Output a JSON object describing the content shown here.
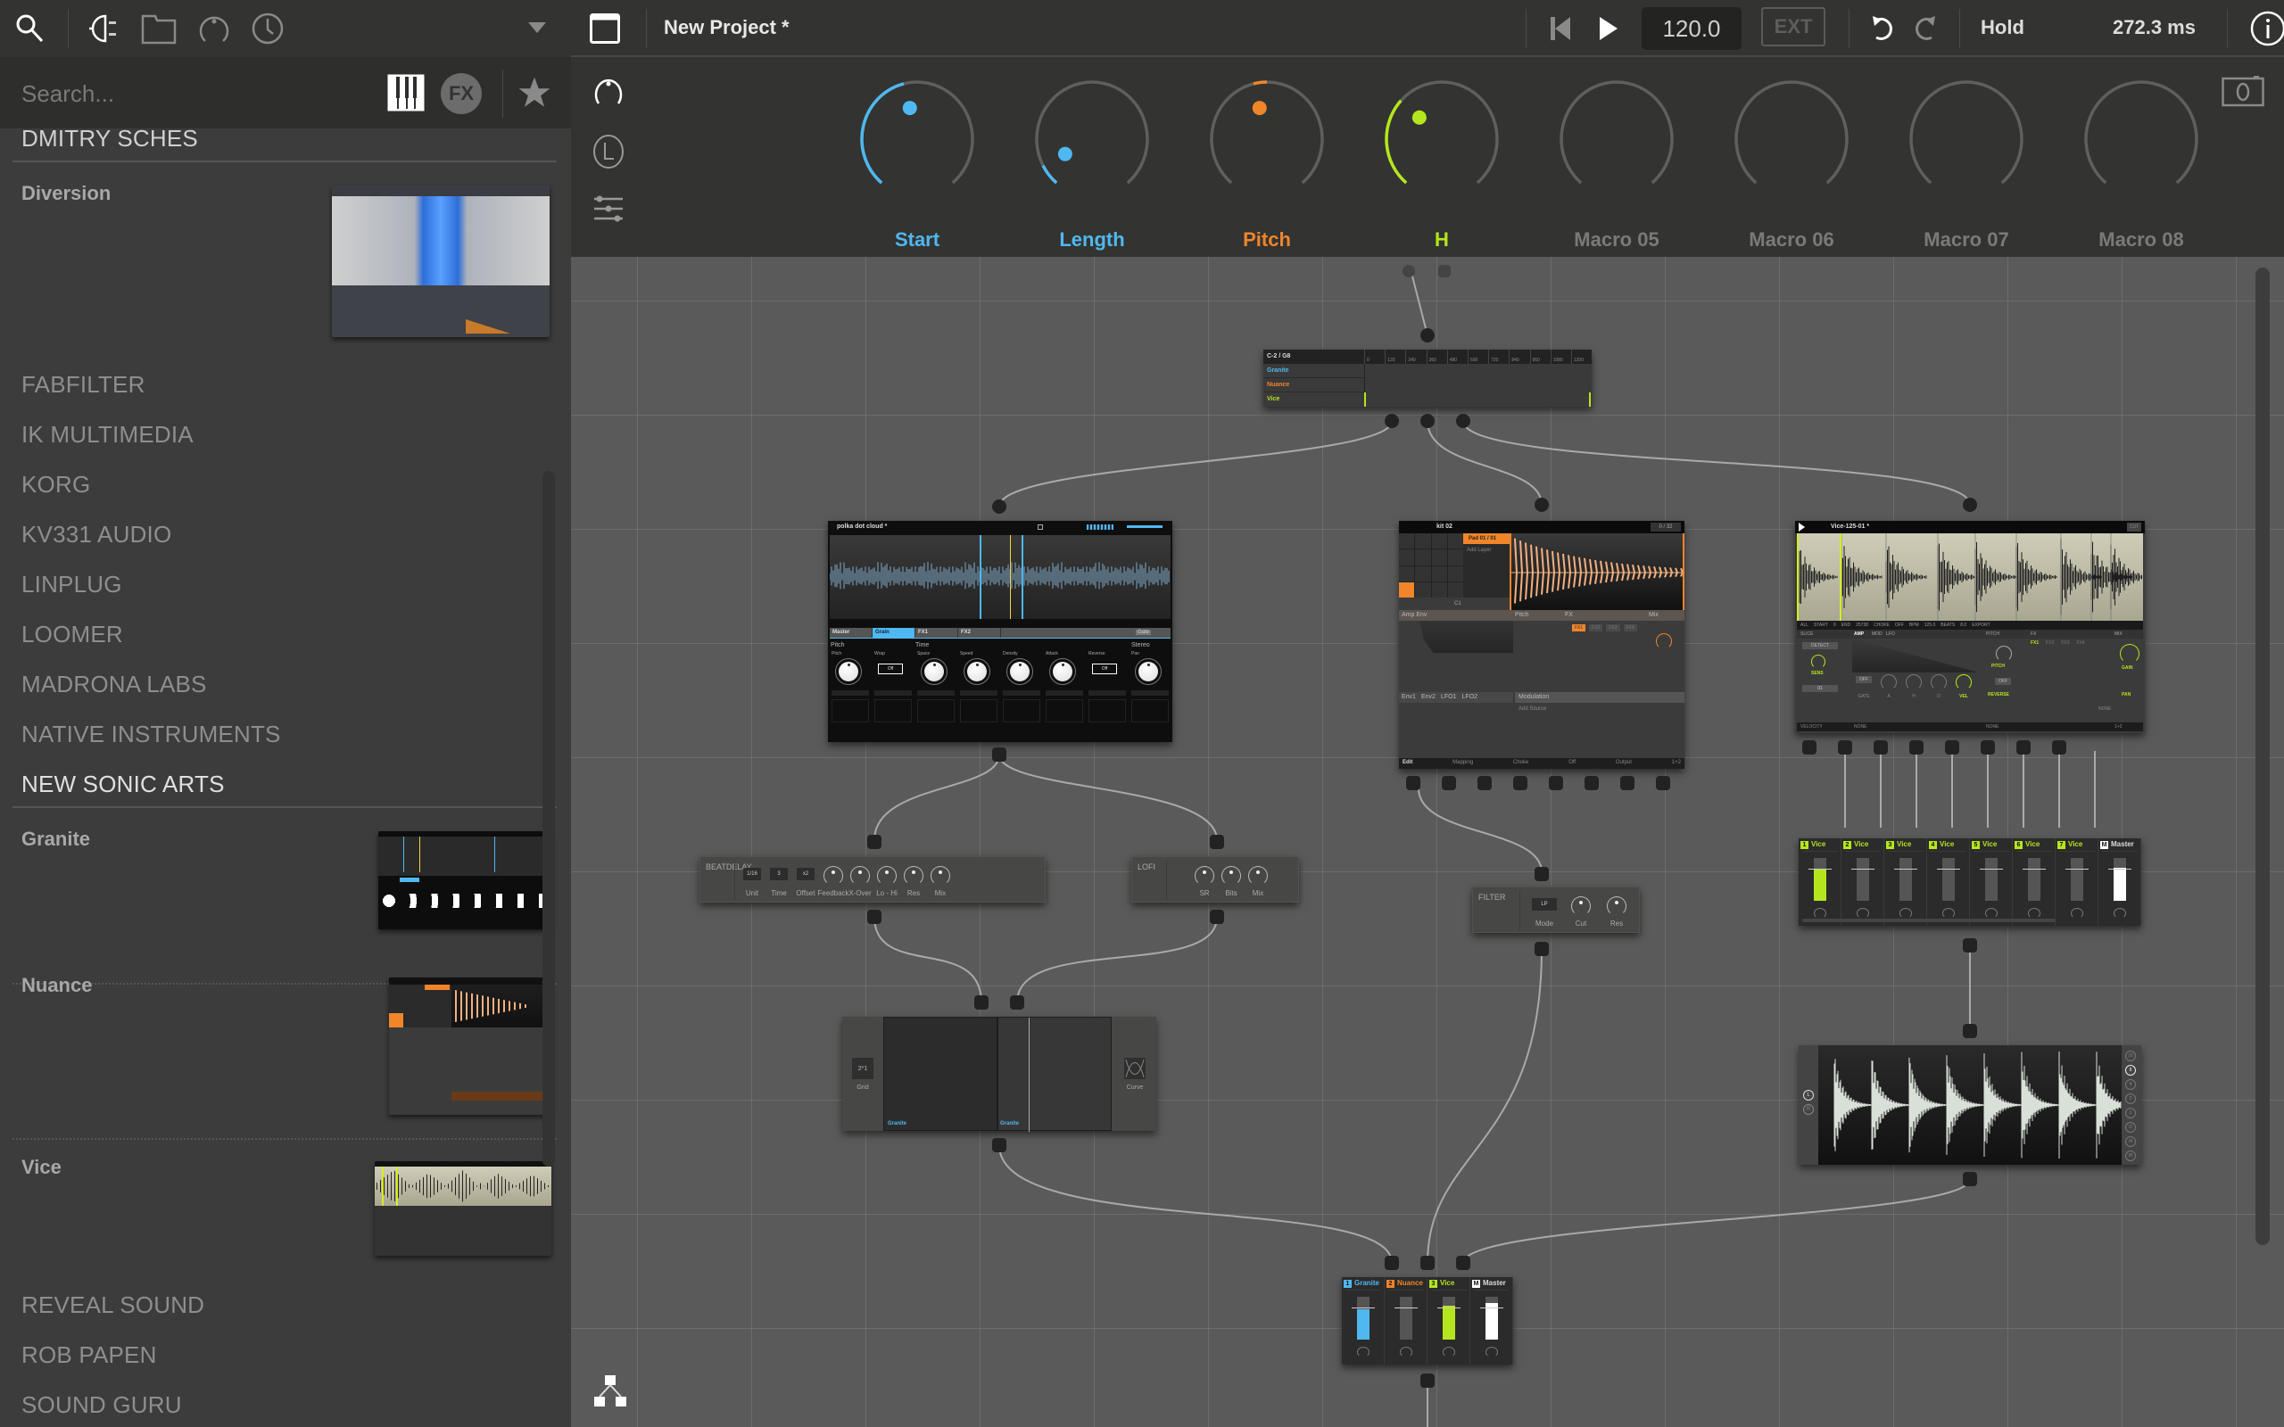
{
  "sidebar": {
    "search_placeholder": "Search...",
    "icons": [
      "search-icon",
      "plugin-icon",
      "folder-icon",
      "macro-knob-icon",
      "history-clock-icon",
      "dropdown-triangle-icon"
    ],
    "filter_icons": [
      "instrument-piano-icon",
      "fx-icon",
      "favorites-star-icon"
    ],
    "fx_label": "FX",
    "vendors_top": [
      "DMITRY SCHES"
    ],
    "products_dmitry": [
      {
        "name": "Diversion"
      }
    ],
    "vendors_mid": [
      "FABFILTER",
      "IK MULTIMEDIA",
      "KORG",
      "KV331 AUDIO",
      "LINPLUG",
      "LOOMER",
      "MADRONA LABS",
      "NATIVE INSTRUMENTS"
    ],
    "vendor_active": "NEW SONIC ARTS",
    "products_nsa": [
      {
        "name": "Granite"
      },
      {
        "name": "Nuance"
      },
      {
        "name": "Vice"
      }
    ],
    "vendors_bottom": [
      "REVEAL SOUND",
      "ROB PAPEN",
      "SOUND GURU"
    ]
  },
  "topbar": {
    "project_title": "New Project *",
    "tempo": "120.0",
    "ext_label": "EXT",
    "hold_label": "Hold",
    "latency": "272.3 ms"
  },
  "macros": [
    {
      "label": "Start",
      "color": "#4fb8f0",
      "value": 0.45
    },
    {
      "label": "Length",
      "color": "#4fb8f0",
      "value": 0.08
    },
    {
      "label": "Pitch",
      "color": "#f0852a",
      "value": 0.45,
      "bipolar": true
    },
    {
      "label": "H",
      "color": "#b5e61d",
      "value": 0.33
    },
    {
      "label": "Macro 05",
      "color": "#666666",
      "value": 0
    },
    {
      "label": "Macro 06",
      "color": "#666666",
      "value": 0
    },
    {
      "label": "Macro 07",
      "color": "#666666",
      "value": 0
    },
    {
      "label": "Macro 08",
      "color": "#666666",
      "value": 0
    }
  ],
  "colors": {
    "granite": "#4fb8f0",
    "nuance": "#f0852a",
    "vice": "#b5e61d",
    "master": "#ffffff"
  },
  "nodes": {
    "keyzone": {
      "range": "C-2 / G8",
      "ticks": [
        "0",
        "120",
        "240",
        "360",
        "480",
        "600",
        "720",
        "840",
        "960",
        "1080",
        "1200"
      ],
      "rows": [
        "Granite",
        "Nuance",
        "Vice"
      ]
    },
    "granite": {
      "preset": "polka dot cloud *",
      "tabs": [
        "Master",
        "Grain",
        "FX1",
        "FX2"
      ],
      "active_tab": "Grain",
      "gate_label": "Gate",
      "sections": [
        "Pitch",
        "Time",
        "Stereo"
      ],
      "params": [
        "Pitch",
        "Wrap",
        "Space",
        "Speed",
        "Density",
        "Attack",
        "Reverse",
        "Pan"
      ],
      "wrap_value": "Off",
      "reverse_value": "Off"
    },
    "nuance": {
      "preset": "kit 02",
      "counter": "0 / 32",
      "pad_label": "Pad 01 / 01",
      "add_layer": "Add Layer",
      "note": "C1",
      "sections": [
        "Amp Env",
        "Pitch",
        "FX",
        "Mix"
      ],
      "fx_tabs": [
        "FX1",
        "FX2",
        "FX3",
        "FX4"
      ],
      "env_tabs": [
        "Env1",
        "Env2",
        "LFO1",
        "LFO2"
      ],
      "modulation": "Modulation",
      "add_source": "Add Source",
      "footer": [
        "Edit",
        "Mapping",
        "Choke",
        "Off",
        "Output",
        "1+2"
      ]
    },
    "vice": {
      "preset": "Vice-125-01 *",
      "mode": "CUT",
      "info_bar": [
        "ALL",
        "START",
        "0",
        "END",
        "25738",
        "CHOKE",
        "OFF",
        "BPM",
        "125.0",
        "BEATS",
        "8.0",
        "EXPORT"
      ],
      "sections": [
        "SLICE",
        "AMP",
        "MOD",
        "LFO",
        "PITCH",
        "FX",
        "MIX"
      ],
      "detect": "DETECT",
      "sens": "SENS",
      "slice_num": "01",
      "amp_params": [
        "GATE",
        "A",
        "H",
        "D",
        "VEL"
      ],
      "gate_value": "OFF",
      "pitch_label": "PITCH",
      "reverse_label": "REVERSE",
      "reverse_value": "OFF",
      "fx_tabs": [
        "FX1",
        "FX2",
        "FX3",
        "FX4"
      ],
      "fx_none": "NONE",
      "mix_params": [
        "GAIN",
        "PAN"
      ],
      "footer": [
        "VELOCITY",
        "NONE",
        "NONE",
        "1+2"
      ]
    },
    "beatdelay": {
      "title": "BEATDELAY",
      "boxes": [
        {
          "label": "Unit",
          "value": "1/16"
        },
        {
          "label": "Time",
          "value": "3"
        },
        {
          "label": "Offset",
          "value": "x2"
        }
      ],
      "knobs": [
        "Feedback",
        "X-Over",
        "Lo - Hi",
        "Res",
        "Mix"
      ]
    },
    "lofi": {
      "title": "LOFI",
      "knobs": [
        "SR",
        "Bits",
        "Mix"
      ]
    },
    "filter": {
      "title": "FILTER",
      "mode_label": "Mode",
      "mode_value": "LP",
      "knobs": [
        "Cut",
        "Res"
      ]
    },
    "xy": {
      "grid_value": "2*1",
      "grid_label": "Grid",
      "curve_label": "Curve",
      "pane_labels": [
        "Granite",
        "Granite"
      ]
    },
    "vice_mixer": {
      "channels": [
        {
          "num": "1",
          "name": "Vice",
          "level": 0.75
        },
        {
          "num": "2",
          "name": "Vice",
          "level": 0
        },
        {
          "num": "3",
          "name": "Vice",
          "level": 0
        },
        {
          "num": "4",
          "name": "Vice",
          "level": 0
        },
        {
          "num": "5",
          "name": "Vice",
          "level": 0
        },
        {
          "num": "6",
          "name": "Vice",
          "level": 0
        },
        {
          "num": "7",
          "name": "Vice",
          "level": 0
        }
      ],
      "master": {
        "num": "M",
        "name": "Master",
        "level": 0.78
      }
    },
    "scope": {
      "channels": [
        "L",
        "R"
      ],
      "divisions": [
        "16",
        "8",
        "4",
        "2",
        "1",
        "/2",
        "/4",
        "/8"
      ],
      "active_division": "8"
    },
    "main_mixer": {
      "channels": [
        {
          "num": "1",
          "name": "Granite",
          "color": "#4fb8f0",
          "level": 0.7
        },
        {
          "num": "2",
          "name": "Nuance",
          "color": "#f0852a",
          "level": 0
        },
        {
          "num": "3",
          "name": "Vice",
          "color": "#b5e61d",
          "level": 0.8
        },
        {
          "num": "M",
          "name": "Master",
          "color": "#ffffff",
          "level": 0.85
        }
      ]
    }
  }
}
